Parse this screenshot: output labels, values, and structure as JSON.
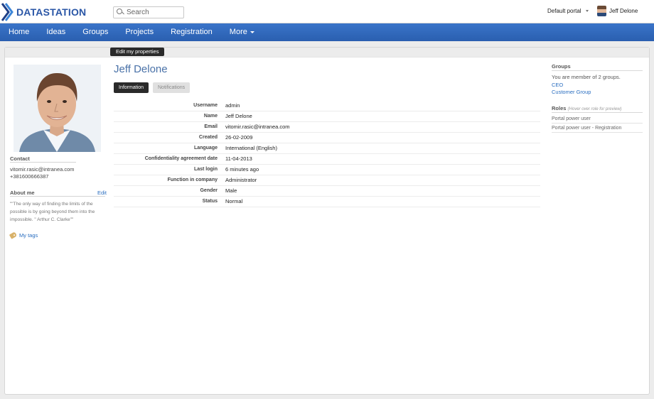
{
  "header": {
    "logo_text": "DATASTATION",
    "search_placeholder": "Search",
    "portal_select": "Default portal",
    "user_name": "Jeff Delone"
  },
  "nav": {
    "items": [
      "Home",
      "Ideas",
      "Groups",
      "Projects",
      "Registration"
    ],
    "more_label": "More"
  },
  "toolbar": {
    "edit_properties_label": "Edit my properties"
  },
  "profile": {
    "name": "Jeff Delone",
    "tabs": {
      "information": "Information",
      "notifications": "Notifications"
    },
    "fields": [
      {
        "label": "Username",
        "value": "admin"
      },
      {
        "label": "Name",
        "value": "Jeff Delone"
      },
      {
        "label": "Email",
        "value": "vitomir.rasic@intranea.com"
      },
      {
        "label": "Created",
        "value": "26-02-2009"
      },
      {
        "label": "Language",
        "value": "International (English)"
      },
      {
        "label": "Confidentiality agreement date",
        "value": "11-04-2013"
      },
      {
        "label": "Last login",
        "value": "6 minutes ago"
      },
      {
        "label": "Function in company",
        "value": "Administrator"
      },
      {
        "label": "Gender",
        "value": "Male"
      },
      {
        "label": "Status",
        "value": "Normal"
      }
    ]
  },
  "sidebar_left": {
    "contact_heading": "Contact",
    "email": "vitomir.rasic@intranea.com",
    "phone": "+381600666387",
    "about_heading": "About me",
    "edit_label": "Edit",
    "about_text": "\"\"The only way of finding the limits of the possible is by going beyond them into the impossible. \" Arthur C. Clarke\"\"",
    "tags_label": "My tags"
  },
  "sidebar_right": {
    "groups_heading": "Groups",
    "groups_summary": "You are member of 2 groups.",
    "groups": [
      "CEO",
      "Customer Group"
    ],
    "roles_heading": "Roles",
    "roles_hint": "(Hover over role for preview)",
    "roles": [
      "Portal power user",
      "Portal power user - Registration"
    ]
  },
  "colors": {
    "brand_blue": "#2a56a6",
    "nav_blue": "#2f67bb",
    "link_blue": "#2a6ec0",
    "name_blue": "#4a72a8"
  }
}
